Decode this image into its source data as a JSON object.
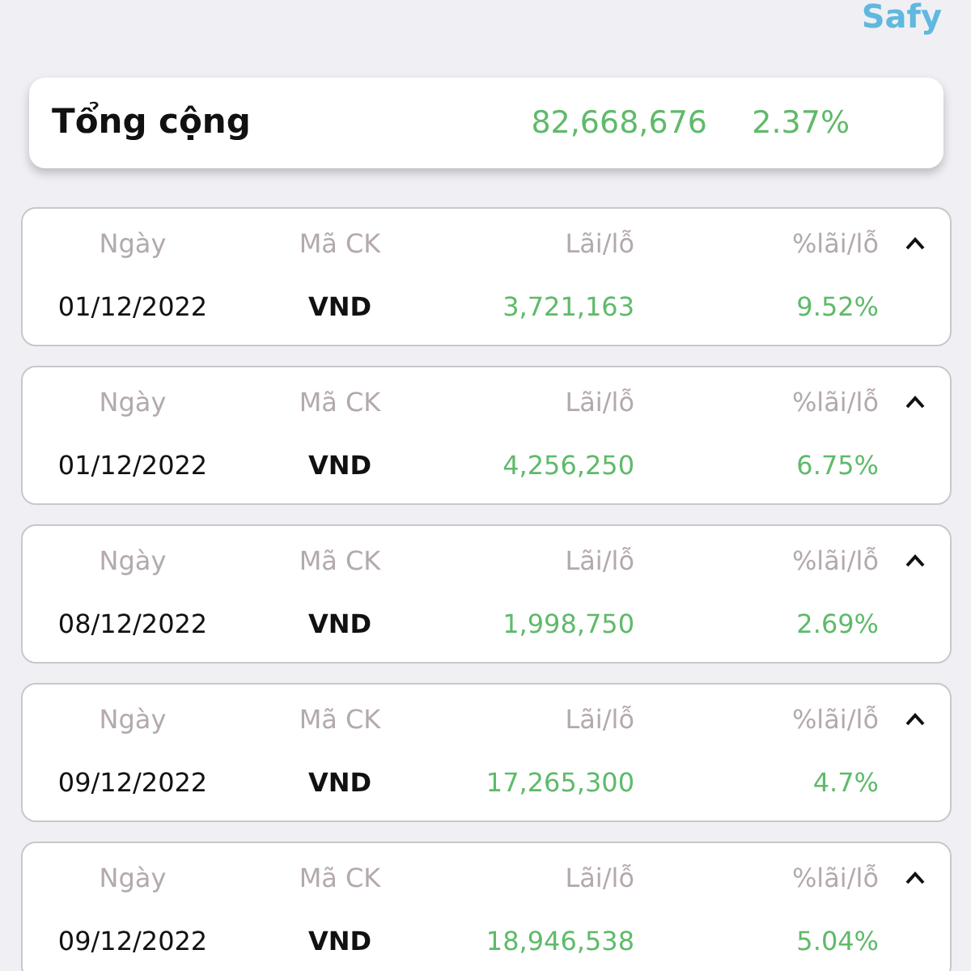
{
  "brand": "Safy",
  "total": {
    "label": "Tổng cộng",
    "amount": "82,668,676",
    "percent": "2.37%"
  },
  "entries": [
    {
      "headers": [
        "Ngày",
        "Mã CK",
        "Lãi/lỗ",
        "%lãi/lỗ"
      ],
      "date": "01/12/2022",
      "code": "VND",
      "pnl": "3,721,163",
      "pct": "9.52%",
      "expanded": true
    },
    {
      "headers": [
        "Ngày",
        "Mã CK",
        "Lãi/lỗ",
        "%lãi/lỗ"
      ],
      "date": "01/12/2022",
      "code": "VND",
      "pnl": "4,256,250",
      "pct": "6.75%",
      "expanded": true
    },
    {
      "headers": [
        "Ngày",
        "Mã CK",
        "Lãi/lỗ",
        "%lãi/lỗ"
      ],
      "date": "08/12/2022",
      "code": "VND",
      "pnl": "1,998,750",
      "pct": "2.69%",
      "expanded": true
    },
    {
      "headers": [
        "Ngày",
        "Mã CK",
        "Lãi/lỗ",
        "%lãi/lỗ"
      ],
      "date": "09/12/2022",
      "code": "VND",
      "pnl": "17,265,300",
      "pct": "4.7%",
      "expanded": true
    },
    {
      "headers": [
        "Ngày",
        "Mã CK",
        "Lãi/lỗ",
        "%lãi/lỗ"
      ],
      "date": "09/12/2022",
      "code": "VND",
      "pnl": "18,946,538",
      "pct": "5.04%",
      "expanded": true
    }
  ]
}
